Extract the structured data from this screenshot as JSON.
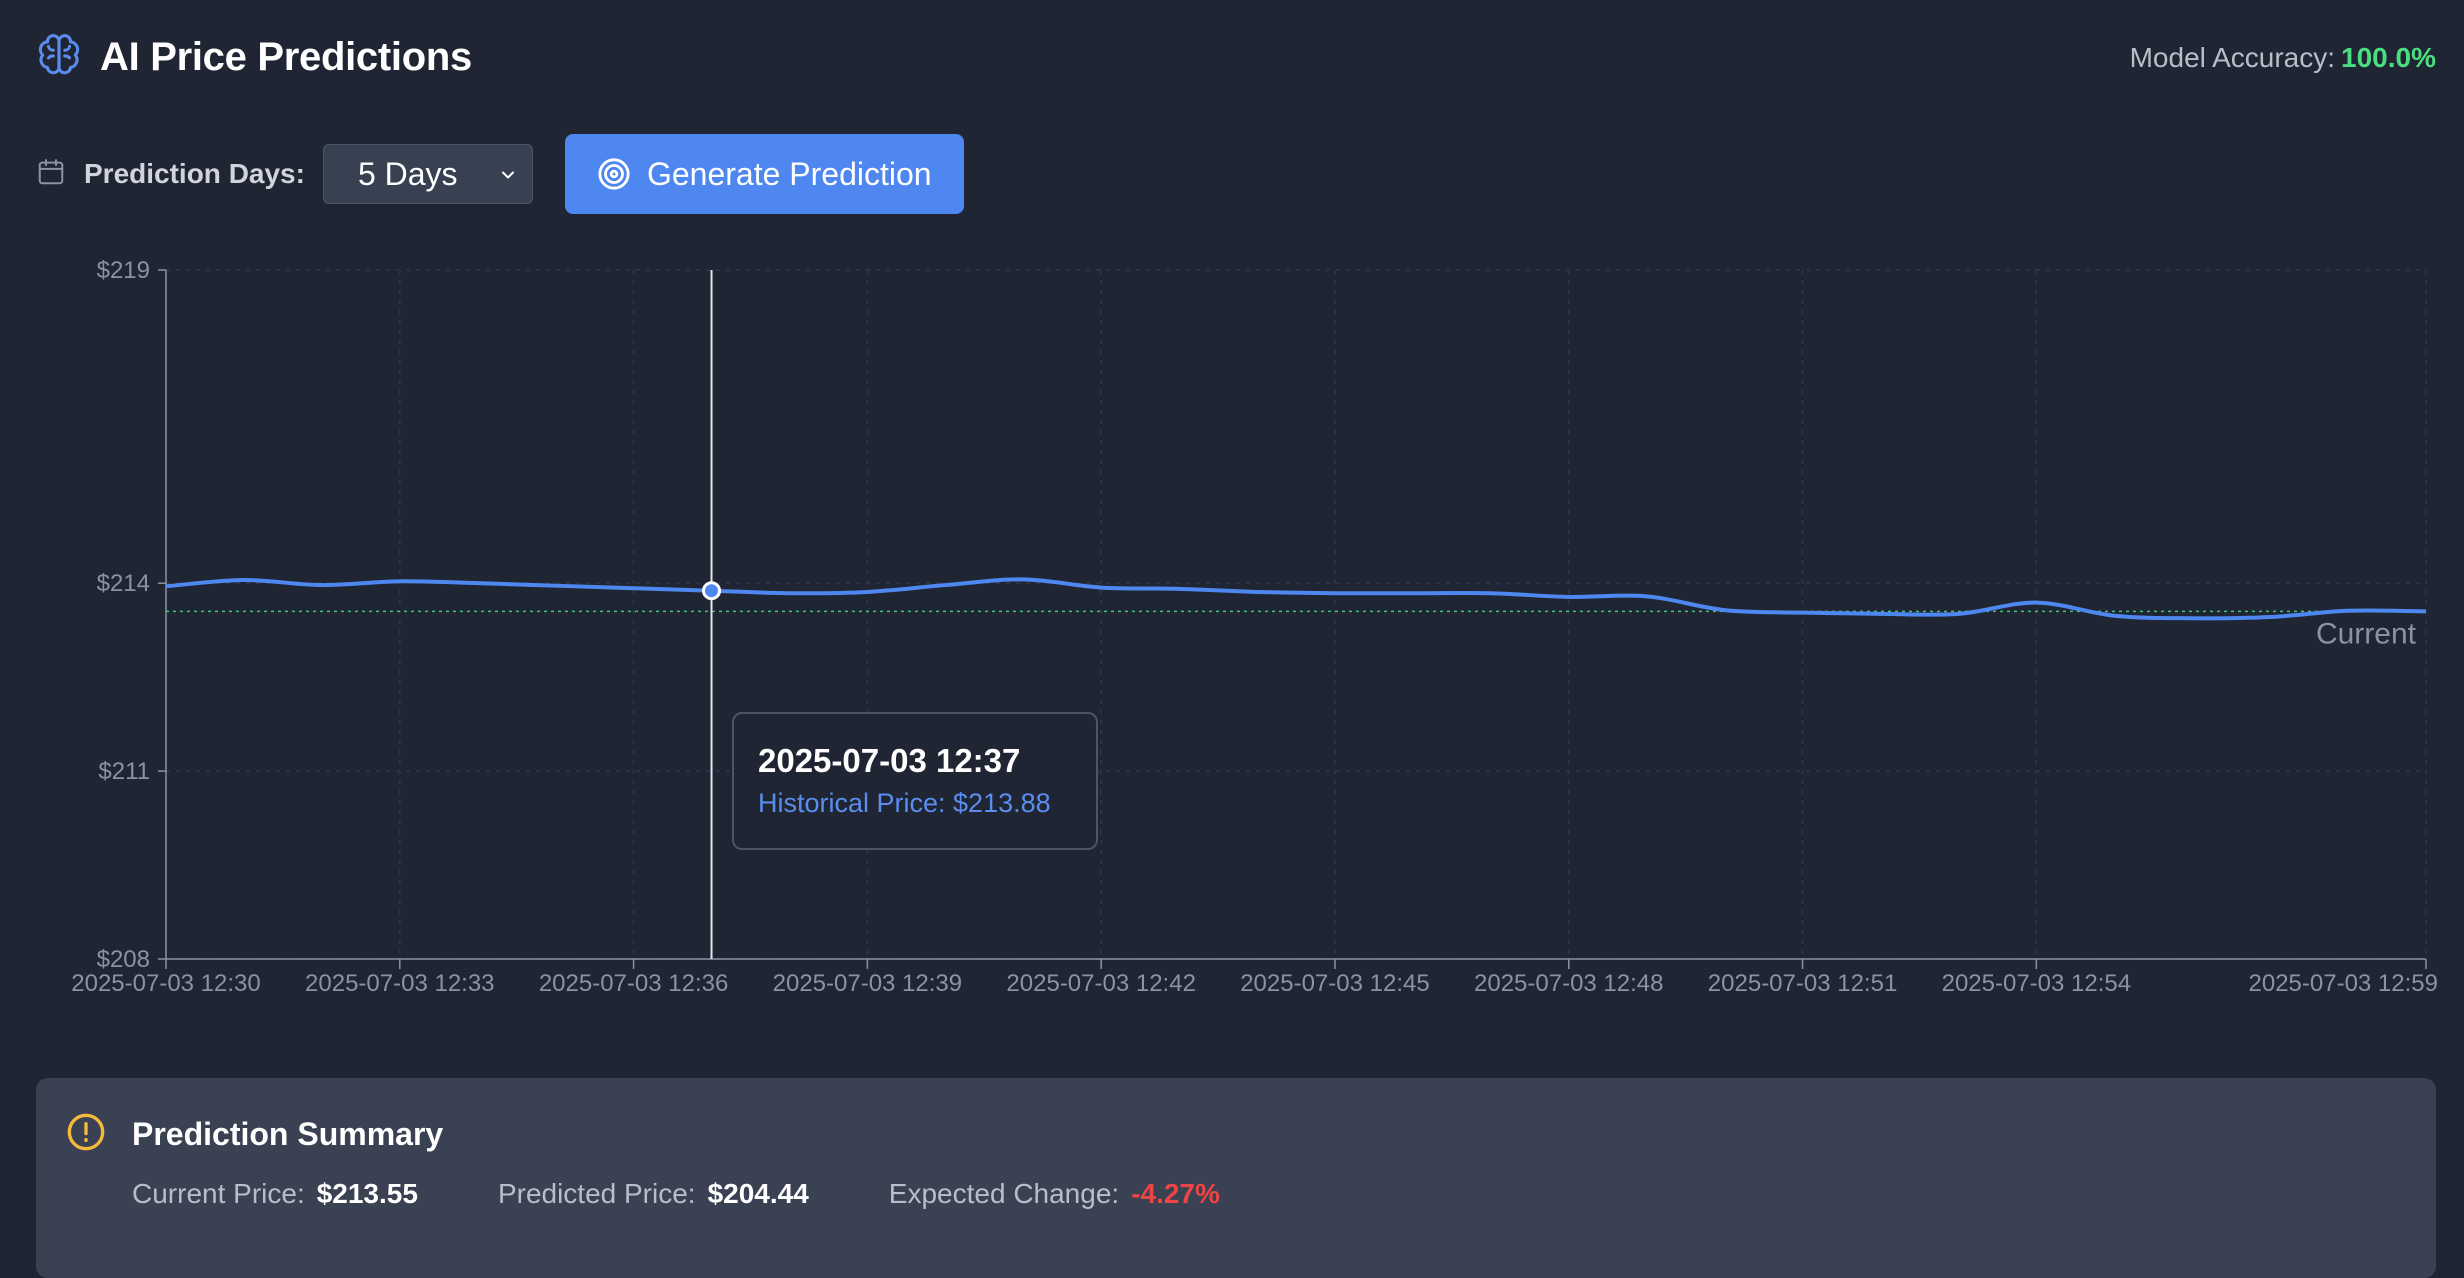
{
  "header": {
    "title": "AI Price Predictions",
    "accuracy_label": "Model Accuracy:",
    "accuracy_value": "100.0%"
  },
  "controls": {
    "days_label": "Prediction Days:",
    "days_selected": "5 Days",
    "generate_label": "Generate Prediction"
  },
  "colors": {
    "accent": "#4f87f0",
    "line": "#4f87f0",
    "positive": "#4ade80",
    "negative": "#ef4444",
    "warning": "#f5b93b"
  },
  "icons": [
    "brain-icon",
    "calendar-icon",
    "chevron-down-icon",
    "target-icon",
    "alert-circle-icon"
  ],
  "chart_data": {
    "type": "line",
    "x": [
      "2025-07-03 12:30",
      "2025-07-03 12:31",
      "2025-07-03 12:32",
      "2025-07-03 12:33",
      "2025-07-03 12:34",
      "2025-07-03 12:35",
      "2025-07-03 12:36",
      "2025-07-03 12:37",
      "2025-07-03 12:38",
      "2025-07-03 12:39",
      "2025-07-03 12:40",
      "2025-07-03 12:41",
      "2025-07-03 12:42",
      "2025-07-03 12:43",
      "2025-07-03 12:44",
      "2025-07-03 12:45",
      "2025-07-03 12:46",
      "2025-07-03 12:47",
      "2025-07-03 12:48",
      "2025-07-03 12:49",
      "2025-07-03 12:50",
      "2025-07-03 12:51",
      "2025-07-03 12:52",
      "2025-07-03 12:53",
      "2025-07-03 12:54",
      "2025-07-03 12:55",
      "2025-07-03 12:56",
      "2025-07-03 12:57",
      "2025-07-03 12:58",
      "2025-07-03 12:59"
    ],
    "series": [
      {
        "name": "Historical Price",
        "values": [
          213.95,
          214.05,
          213.97,
          214.03,
          214.0,
          213.96,
          213.92,
          213.88,
          213.84,
          213.86,
          213.97,
          214.06,
          213.93,
          213.91,
          213.86,
          213.84,
          213.84,
          213.84,
          213.78,
          213.79,
          213.57,
          213.53,
          213.51,
          213.51,
          213.69,
          213.48,
          213.44,
          213.46,
          213.56,
          213.55
        ]
      }
    ],
    "reference_line": {
      "label": "Current",
      "value": 213.55
    },
    "x_ticks": [
      "2025-07-03 12:30",
      "2025-07-03 12:33",
      "2025-07-03 12:36",
      "2025-07-03 12:39",
      "2025-07-03 12:42",
      "2025-07-03 12:45",
      "2025-07-03 12:48",
      "2025-07-03 12:51",
      "2025-07-03 12:54",
      "2025-07-03 12:59"
    ],
    "y_ticks": [
      "$208",
      "$211",
      "$214",
      "$219"
    ],
    "ylim": [
      208,
      219
    ],
    "grid": true,
    "tooltip": {
      "time": "2025-07-03 12:37",
      "text": "Historical Price: $213.88",
      "index": 7
    }
  },
  "summary": {
    "title": "Prediction Summary",
    "current_label": "Current Price:",
    "current_value": "$213.55",
    "predicted_label": "Predicted Price:",
    "predicted_value": "$204.44",
    "change_label": "Expected Change:",
    "change_value": "-4.27%"
  }
}
